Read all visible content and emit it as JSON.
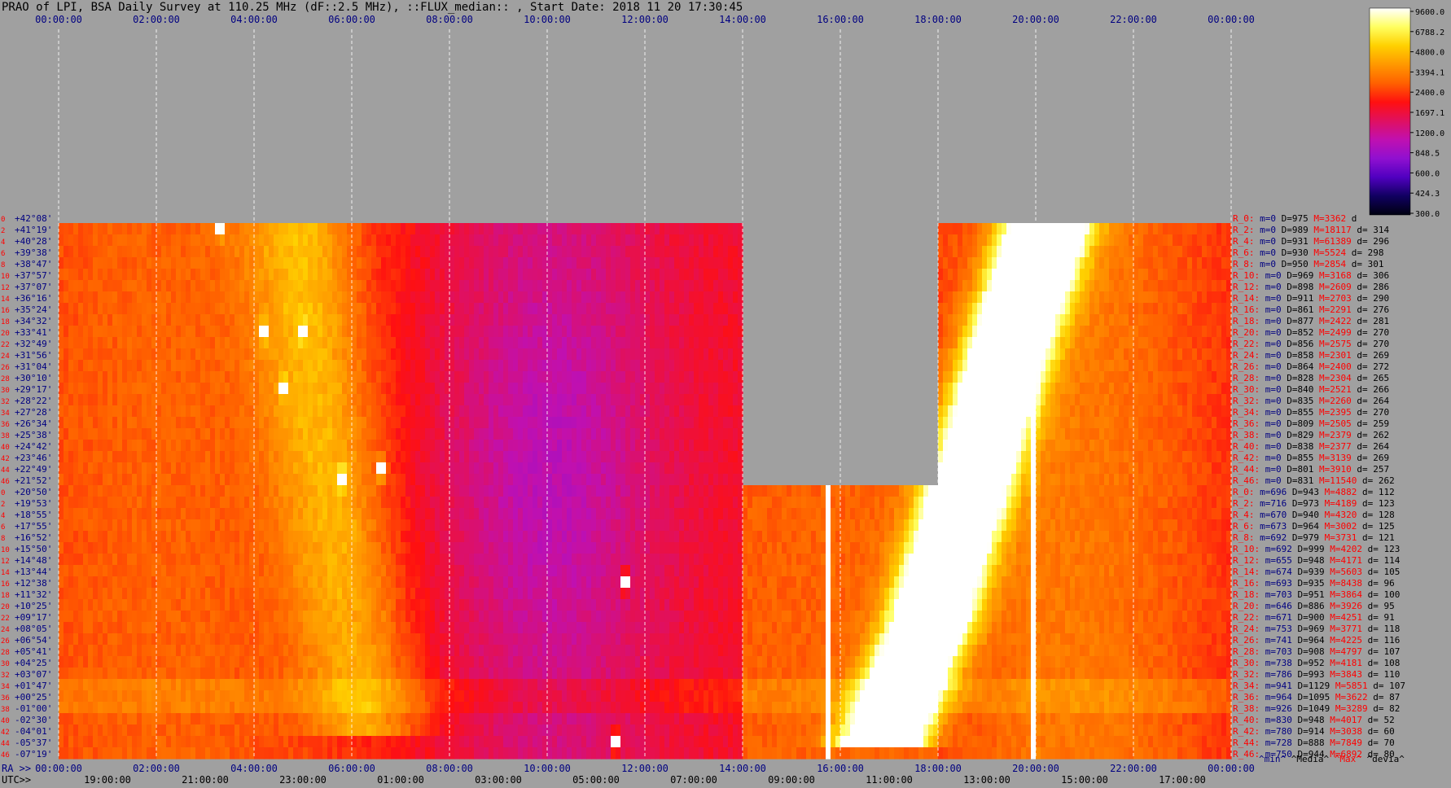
{
  "title": "PRAO of LPI, BSA Daily Survey at 110.25 MHz (dF::2.5 MHz), ::FLUX_median:: , Start Date: 2018 11 20 17:30:45",
  "colors": {
    "background": "#a0a0a0",
    "gap": "#a0a0a0",
    "ra_ticks": "#000080",
    "utc_ticks": "#000000",
    "beam_label": "#ff0000",
    "dec_label": "#000080",
    "stat_min": "#000080",
    "stat_max": "#ff0000",
    "stat_text": "#000000"
  },
  "chart_data": {
    "type": "heatmap",
    "title": "PRAO of LPI, BSA Daily Survey at 110.25 MHz (dF::2.5 MHz), ::FLUX_median:: , Start Date: 2018 11 20 17:30:45",
    "x_axis_top": {
      "ticks": [
        "00:00:00",
        "02:00:00",
        "04:00:00",
        "06:00:00",
        "08:00:00",
        "10:00:00",
        "12:00:00",
        "14:00:00",
        "16:00:00",
        "18:00:00",
        "20:00:00",
        "22:00:00",
        "00:00:00"
      ]
    },
    "x_axis_bottom_ra": {
      "prefix": "RA >>",
      "ticks": [
        "00:00:00",
        "02:00:00",
        "04:00:00",
        "06:00:00",
        "08:00:00",
        "10:00:00",
        "12:00:00",
        "14:00:00",
        "16:00:00",
        "18:00:00",
        "20:00:00",
        "22:00:00",
        "00:00:00"
      ]
    },
    "x_axis_bottom_utc": {
      "prefix": "UTC>>",
      "ticks": [
        "19:00:00",
        "21:00:00",
        "23:00:00",
        "01:00:00",
        "03:00:00",
        "05:00:00",
        "07:00:00",
        "09:00:00",
        "11:00:00",
        "13:00:00",
        "15:00:00",
        "17:00:00"
      ]
    },
    "x_range_ra_hours": [
      0,
      24
    ],
    "grid": true,
    "grid_hours": [
      0,
      2,
      4,
      6,
      8,
      10,
      12,
      14,
      16,
      18,
      20,
      22,
      24
    ],
    "gaps": [
      {
        "ra_start_h": 14,
        "ra_end_h": 18,
        "rows_missing": [
          0,
          23
        ]
      }
    ],
    "rows_top_to_bottom": [
      {
        "beam": 0,
        "dec": "+42°08'",
        "data": false
      },
      {
        "beam": 2,
        "dec": "+41°19'",
        "data": true
      },
      {
        "beam": 4,
        "dec": "+40°28'",
        "data": true
      },
      {
        "beam": 6,
        "dec": "+39°38'",
        "data": true
      },
      {
        "beam": 8,
        "dec": "+38°47'",
        "data": true
      },
      {
        "beam": 10,
        "dec": "+37°57'",
        "data": true
      },
      {
        "beam": 12,
        "dec": "+37°07'",
        "data": true
      },
      {
        "beam": 14,
        "dec": "+36°16'",
        "data": true
      },
      {
        "beam": 16,
        "dec": "+35°24'",
        "data": true
      },
      {
        "beam": 18,
        "dec": "+34°32'",
        "data": true
      },
      {
        "beam": 20,
        "dec": "+33°41'",
        "data": true
      },
      {
        "beam": 22,
        "dec": "+32°49'",
        "data": true
      },
      {
        "beam": 24,
        "dec": "+31°56'",
        "data": true
      },
      {
        "beam": 26,
        "dec": "+31°04'",
        "data": true
      },
      {
        "beam": 28,
        "dec": "+30°10'",
        "data": true
      },
      {
        "beam": 30,
        "dec": "+29°17'",
        "data": true
      },
      {
        "beam": 32,
        "dec": "+28°22'",
        "data": true
      },
      {
        "beam": 34,
        "dec": "+27°28'",
        "data": true
      },
      {
        "beam": 36,
        "dec": "+26°34'",
        "data": true
      },
      {
        "beam": 38,
        "dec": "+25°38'",
        "data": true
      },
      {
        "beam": 40,
        "dec": "+24°42'",
        "data": true
      },
      {
        "beam": 42,
        "dec": "+23°46'",
        "data": true
      },
      {
        "beam": 44,
        "dec": "+22°49'",
        "data": true
      },
      {
        "beam": 46,
        "dec": "+21°52'",
        "data": true
      },
      {
        "beam": 0,
        "dec": "+20°50'",
        "data": true
      },
      {
        "beam": 2,
        "dec": "+19°53'",
        "data": true
      },
      {
        "beam": 4,
        "dec": "+18°55'",
        "data": true
      },
      {
        "beam": 6,
        "dec": "+17°55'",
        "data": true
      },
      {
        "beam": 8,
        "dec": "+16°52'",
        "data": true
      },
      {
        "beam": 10,
        "dec": "+15°50'",
        "data": true
      },
      {
        "beam": 12,
        "dec": "+14°48'",
        "data": true
      },
      {
        "beam": 14,
        "dec": "+13°44'",
        "data": true
      },
      {
        "beam": 16,
        "dec": "+12°38'",
        "data": true
      },
      {
        "beam": 18,
        "dec": "+11°32'",
        "data": true
      },
      {
        "beam": 20,
        "dec": "+10°25'",
        "data": true
      },
      {
        "beam": 22,
        "dec": "+09°17'",
        "data": true
      },
      {
        "beam": 24,
        "dec": "+08°05'",
        "data": true
      },
      {
        "beam": 26,
        "dec": "+06°54'",
        "data": true
      },
      {
        "beam": 28,
        "dec": "+05°41'",
        "data": true
      },
      {
        "beam": 30,
        "dec": "+04°25'",
        "data": true
      },
      {
        "beam": 32,
        "dec": "+03°07'",
        "data": true
      },
      {
        "beam": 34,
        "dec": "+01°47'",
        "data": true
      },
      {
        "beam": 36,
        "dec": "+00°25'",
        "data": true
      },
      {
        "beam": 38,
        "dec": "-01°00'",
        "data": true
      },
      {
        "beam": 40,
        "dec": "-02°30'",
        "data": true
      },
      {
        "beam": 42,
        "dec": "-04°01'",
        "data": true
      },
      {
        "beam": 44,
        "dec": "-05°37'",
        "data": true
      },
      {
        "beam": 46,
        "dec": "-07°19'",
        "data": true
      }
    ],
    "row_stats_top_to_bottom": [
      {
        "label": "R_0:",
        "m": "m=0",
        "D": "D=975",
        "M": "M=3362",
        "d": "d"
      },
      {
        "label": "R_2:",
        "m": "m=0",
        "D": "D=989",
        "M": "M=18117",
        "d": "d= 314"
      },
      {
        "label": "R_4:",
        "m": "m=0",
        "D": "D=931",
        "M": "M=61389",
        "d": "d= 296"
      },
      {
        "label": "R_6:",
        "m": "m=0",
        "D": "D=930",
        "M": "M=5524",
        "d": "d= 298"
      },
      {
        "label": "R_8:",
        "m": "m=0",
        "D": "D=950",
        "M": "M=2854",
        "d": "d= 301"
      },
      {
        "label": "R_10:",
        "m": "m=0",
        "D": "D=969",
        "M": "M=3168",
        "d": "d= 306"
      },
      {
        "label": "R_12:",
        "m": "m=0",
        "D": "D=898",
        "M": "M=2609",
        "d": "d= 286"
      },
      {
        "label": "R_14:",
        "m": "m=0",
        "D": "D=911",
        "M": "M=2703",
        "d": "d= 290"
      },
      {
        "label": "R_16:",
        "m": "m=0",
        "D": "D=861",
        "M": "M=2291",
        "d": "d= 276"
      },
      {
        "label": "R_18:",
        "m": "m=0",
        "D": "D=877",
        "M": "M=2422",
        "d": "d= 281"
      },
      {
        "label": "R_20:",
        "m": "m=0",
        "D": "D=852",
        "M": "M=2499",
        "d": "d= 270"
      },
      {
        "label": "R_22:",
        "m": "m=0",
        "D": "D=856",
        "M": "M=2575",
        "d": "d= 270"
      },
      {
        "label": "R_24:",
        "m": "m=0",
        "D": "D=858",
        "M": "M=2301",
        "d": "d= 269"
      },
      {
        "label": "R_26:",
        "m": "m=0",
        "D": "D=864",
        "M": "M=2400",
        "d": "d= 272"
      },
      {
        "label": "R_28:",
        "m": "m=0",
        "D": "D=828",
        "M": "M=2304",
        "d": "d= 265"
      },
      {
        "label": "R_30:",
        "m": "m=0",
        "D": "D=840",
        "M": "M=2521",
        "d": "d= 266"
      },
      {
        "label": "R_32:",
        "m": "m=0",
        "D": "D=835",
        "M": "M=2260",
        "d": "d= 264"
      },
      {
        "label": "R_34:",
        "m": "m=0",
        "D": "D=855",
        "M": "M=2395",
        "d": "d= 270"
      },
      {
        "label": "R_36:",
        "m": "m=0",
        "D": "D=809",
        "M": "M=2505",
        "d": "d= 259"
      },
      {
        "label": "R_38:",
        "m": "m=0",
        "D": "D=829",
        "M": "M=2379",
        "d": "d= 262"
      },
      {
        "label": "R_40:",
        "m": "m=0",
        "D": "D=838",
        "M": "M=2377",
        "d": "d= 264"
      },
      {
        "label": "R_42:",
        "m": "m=0",
        "D": "D=855",
        "M": "M=3139",
        "d": "d= 269"
      },
      {
        "label": "R_44:",
        "m": "m=0",
        "D": "D=801",
        "M": "M=3910",
        "d": "d= 257"
      },
      {
        "label": "R_46:",
        "m": "m=0",
        "D": "D=831",
        "M": "M=11540",
        "d": "d= 262"
      },
      {
        "label": "R_0:",
        "m": "m=696",
        "D": "D=943",
        "M": "M=4882",
        "d": "d= 112"
      },
      {
        "label": "R_2:",
        "m": "m=716",
        "D": "D=973",
        "M": "M=4189",
        "d": "d= 123"
      },
      {
        "label": "R_4:",
        "m": "m=670",
        "D": "D=940",
        "M": "M=4320",
        "d": "d= 128"
      },
      {
        "label": "R_6:",
        "m": "m=673",
        "D": "D=964",
        "M": "M=3002",
        "d": "d= 125"
      },
      {
        "label": "R_8:",
        "m": "m=692",
        "D": "D=979",
        "M": "M=3731",
        "d": "d= 121"
      },
      {
        "label": "R_10:",
        "m": "m=692",
        "D": "D=999",
        "M": "M=4202",
        "d": "d= 123"
      },
      {
        "label": "R_12:",
        "m": "m=655",
        "D": "D=948",
        "M": "M=4171",
        "d": "d= 114"
      },
      {
        "label": "R_14:",
        "m": "m=674",
        "D": "D=939",
        "M": "M=5603",
        "d": "d= 105"
      },
      {
        "label": "R_16:",
        "m": "m=693",
        "D": "D=935",
        "M": "M=8438",
        "d": "d= 96"
      },
      {
        "label": "R_18:",
        "m": "m=703",
        "D": "D=951",
        "M": "M=3864",
        "d": "d= 100"
      },
      {
        "label": "R_20:",
        "m": "m=646",
        "D": "D=886",
        "M": "M=3926",
        "d": "d= 95"
      },
      {
        "label": "R_22:",
        "m": "m=671",
        "D": "D=900",
        "M": "M=4251",
        "d": "d= 91"
      },
      {
        "label": "R_24:",
        "m": "m=753",
        "D": "D=969",
        "M": "M=3771",
        "d": "d= 118"
      },
      {
        "label": "R_26:",
        "m": "m=741",
        "D": "D=964",
        "M": "M=4225",
        "d": "d= 116"
      },
      {
        "label": "R_28:",
        "m": "m=703",
        "D": "D=908",
        "M": "M=4797",
        "d": "d= 107"
      },
      {
        "label": "R_30:",
        "m": "m=738",
        "D": "D=952",
        "M": "M=4181",
        "d": "d= 108"
      },
      {
        "label": "R_32:",
        "m": "m=786",
        "D": "D=993",
        "M": "M=3843",
        "d": "d= 110"
      },
      {
        "label": "R_34:",
        "m": "m=941",
        "D": "D=1129",
        "M": "M=5851",
        "d": "d= 107"
      },
      {
        "label": "R_36:",
        "m": "m=964",
        "D": "D=1095",
        "M": "M=3622",
        "d": "d= 87"
      },
      {
        "label": "R_38:",
        "m": "m=926",
        "D": "D=1049",
        "M": "M=3289",
        "d": "d= 82"
      },
      {
        "label": "R_40:",
        "m": "m=830",
        "D": "D=948",
        "M": "M=4017",
        "d": "d= 52"
      },
      {
        "label": "R_42:",
        "m": "m=780",
        "D": "D=914",
        "M": "M=3038",
        "d": "d= 60"
      },
      {
        "label": "R_44:",
        "m": "m=728",
        "D": "D=888",
        "M": "M=7849",
        "d": "d= 70"
      },
      {
        "label": "R_46:",
        "m": "m=750",
        "D": "D=944",
        "M": "M=6892",
        "d": "d= 80"
      }
    ],
    "stats_legend": [
      "^min^",
      "^Media^",
      "^Max^",
      "^devia^"
    ],
    "colorbar": {
      "tick_labels": [
        "9600.0",
        "6788.2",
        "4800.0",
        "3394.1",
        "2400.0",
        "1697.1",
        "1200.0",
        "848.5",
        "600.0",
        "424.3",
        "300.0"
      ],
      "range": [
        300,
        9600
      ],
      "scale": "log",
      "stops": [
        "#000010",
        "#100060",
        "#5000c0",
        "#9010d0",
        "#c010b0",
        "#e01060",
        "#ff1010",
        "#ff6000",
        "#ff9800",
        "#ffd000",
        "#ffff60",
        "#ffffff"
      ]
    },
    "features": [
      {
        "kind": "band",
        "desc": "galactic plane",
        "points_ra_h": [
          [
            16.8,
            46.5
          ],
          [
            17.8,
            36
          ],
          [
            19.4,
            12
          ],
          [
            20.3,
            0
          ]
        ],
        "halfwidth_h": 0.55,
        "amp": 1.05
      },
      {
        "kind": "band",
        "desc": "broad emission ridge",
        "points_ra_h": [
          [
            4.9,
            0
          ],
          [
            5.5,
            23
          ],
          [
            6.3,
            45
          ]
        ],
        "halfwidth_h": 0.8,
        "amp": 0.2
      },
      {
        "kind": "vline",
        "ra_h": 19.95,
        "row_start": 1,
        "row_end": 47,
        "amp": 0.85
      },
      {
        "kind": "vline",
        "ra_h": 15.75,
        "row_start": 24,
        "row_end": 47,
        "amp": 0.7
      },
      {
        "kind": "source",
        "ra_h": 19.8,
        "row": 2,
        "amp": 1.45,
        "desc": "bright source"
      },
      {
        "kind": "source",
        "ra_h": 5.8,
        "row": 23,
        "amp": 1.1
      },
      {
        "kind": "source",
        "ra_h": 11.6,
        "row": 32,
        "amp": 1.05
      },
      {
        "kind": "source",
        "ra_h": 11.4,
        "row": 46,
        "amp": 1.05
      },
      {
        "kind": "source",
        "ra_h": 6.6,
        "row": 22,
        "amp": 0.8
      },
      {
        "kind": "source",
        "ra_h": 4.2,
        "row": 10,
        "amp": 0.55
      },
      {
        "kind": "source",
        "ra_h": 5.0,
        "row": 10,
        "amp": 0.5
      },
      {
        "kind": "source",
        "ra_h": 3.3,
        "row": 1,
        "amp": 0.55
      },
      {
        "kind": "source",
        "ra_h": 4.6,
        "row": 15,
        "amp": 0.5
      },
      {
        "kind": "source",
        "ra_h": 17.2,
        "row": 38,
        "amp": 0.7
      }
    ]
  }
}
